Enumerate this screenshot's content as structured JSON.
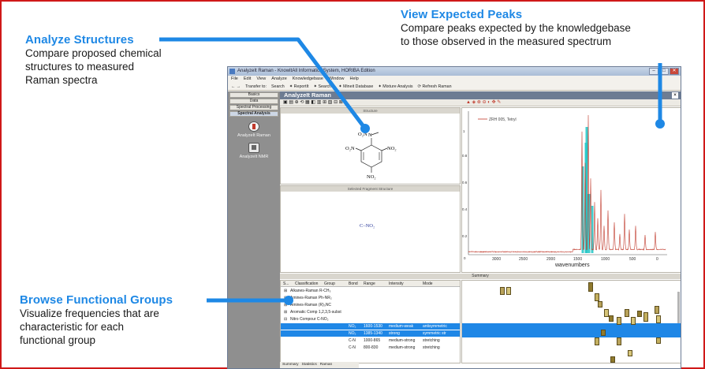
{
  "callouts": {
    "analyze": {
      "title": "Analyze Structures",
      "lines": [
        "Compare proposed chemical",
        "structures to measured",
        "Raman spectra"
      ]
    },
    "peaks": {
      "title": "View Expected Peaks",
      "lines": [
        "Compare peaks expected by the knowledgebase",
        "to those observed in the measured spectrum"
      ]
    },
    "browse": {
      "title": "Browse Functional Groups",
      "lines": [
        "Visualize frequencies that are",
        "characteristic for each",
        "functional group"
      ]
    }
  },
  "window": {
    "title": "AnalyzeIt Raman - KnowItAll Informatics System, HORIBA Edition",
    "menu": [
      "File",
      "Edit",
      "View",
      "Analyze",
      "Knowledgebase",
      "Window",
      "Help"
    ],
    "toolbar": [
      "← →",
      "Transfer to:",
      "Search",
      "✦ ReportIt",
      "✦ SearchIt",
      "✦ Mineit Database",
      "✦ Mixture Analysis",
      "⟳ Refresh Raman"
    ],
    "sidebar": {
      "buttons": [
        "Basics",
        "Data",
        "Spectral Processing",
        "Spectral Analysis"
      ],
      "tools": [
        "AnalyzeIt Raman",
        "AnalyzeIt NMR"
      ]
    },
    "main_title": "AnalyzeIt Raman",
    "structure_pane_title": "Structure",
    "fragment_pane_title": "Selected Fragment Structure",
    "fragment_label": "C–NO₂",
    "molecule": {
      "top_left": "O₂N",
      "n_label": "N",
      "left": "O₂N",
      "right": "NO₂",
      "bottom": "NO₂"
    },
    "spectrum": {
      "legend": "ZRH 005, Tetryl",
      "xlabel": "wavenumbers",
      "xticks": [
        "3000",
        "2500",
        "2000",
        "1500",
        "1000",
        "500",
        "0"
      ],
      "yticks": [
        "1",
        "0.8",
        "0.6",
        "0.4",
        "0.2",
        "0"
      ]
    },
    "summary_title": "Summary",
    "table": {
      "headers": [
        "S...",
        "Classification",
        "Group",
        "Bond",
        "Range",
        "Intensity",
        "Mode"
      ],
      "tree": [
        "Alkanes-Raman R-CH₃",
        "Amines-Raman Ph-NR₂",
        "Amines-Raman (R)₃NC",
        "Aromatic Comp 1,2,3,5-subst",
        "Nitro Compour C-NO₂"
      ],
      "rows": [
        {
          "bond": "NO₂",
          "range": "1600-1530",
          "intensity": "medium-weak",
          "mode": "antisymmetric"
        },
        {
          "bond": "NO₂",
          "range": "1385-1340",
          "intensity": "strong",
          "mode": "symmetric str"
        },
        {
          "bond": "C-N",
          "range": "1000-865",
          "intensity": "medium-strong",
          "mode": "stretching"
        },
        {
          "bond": "C-N",
          "range": "800-830",
          "intensity": "medium-strong",
          "mode": "stretching"
        }
      ]
    },
    "bottom_tabs": [
      "Summary",
      "Statistics",
      "Raman"
    ],
    "accent": "#1e88e5",
    "spectrum_color": "#c0392b",
    "expected_peak_color": "#1fc6c6"
  }
}
